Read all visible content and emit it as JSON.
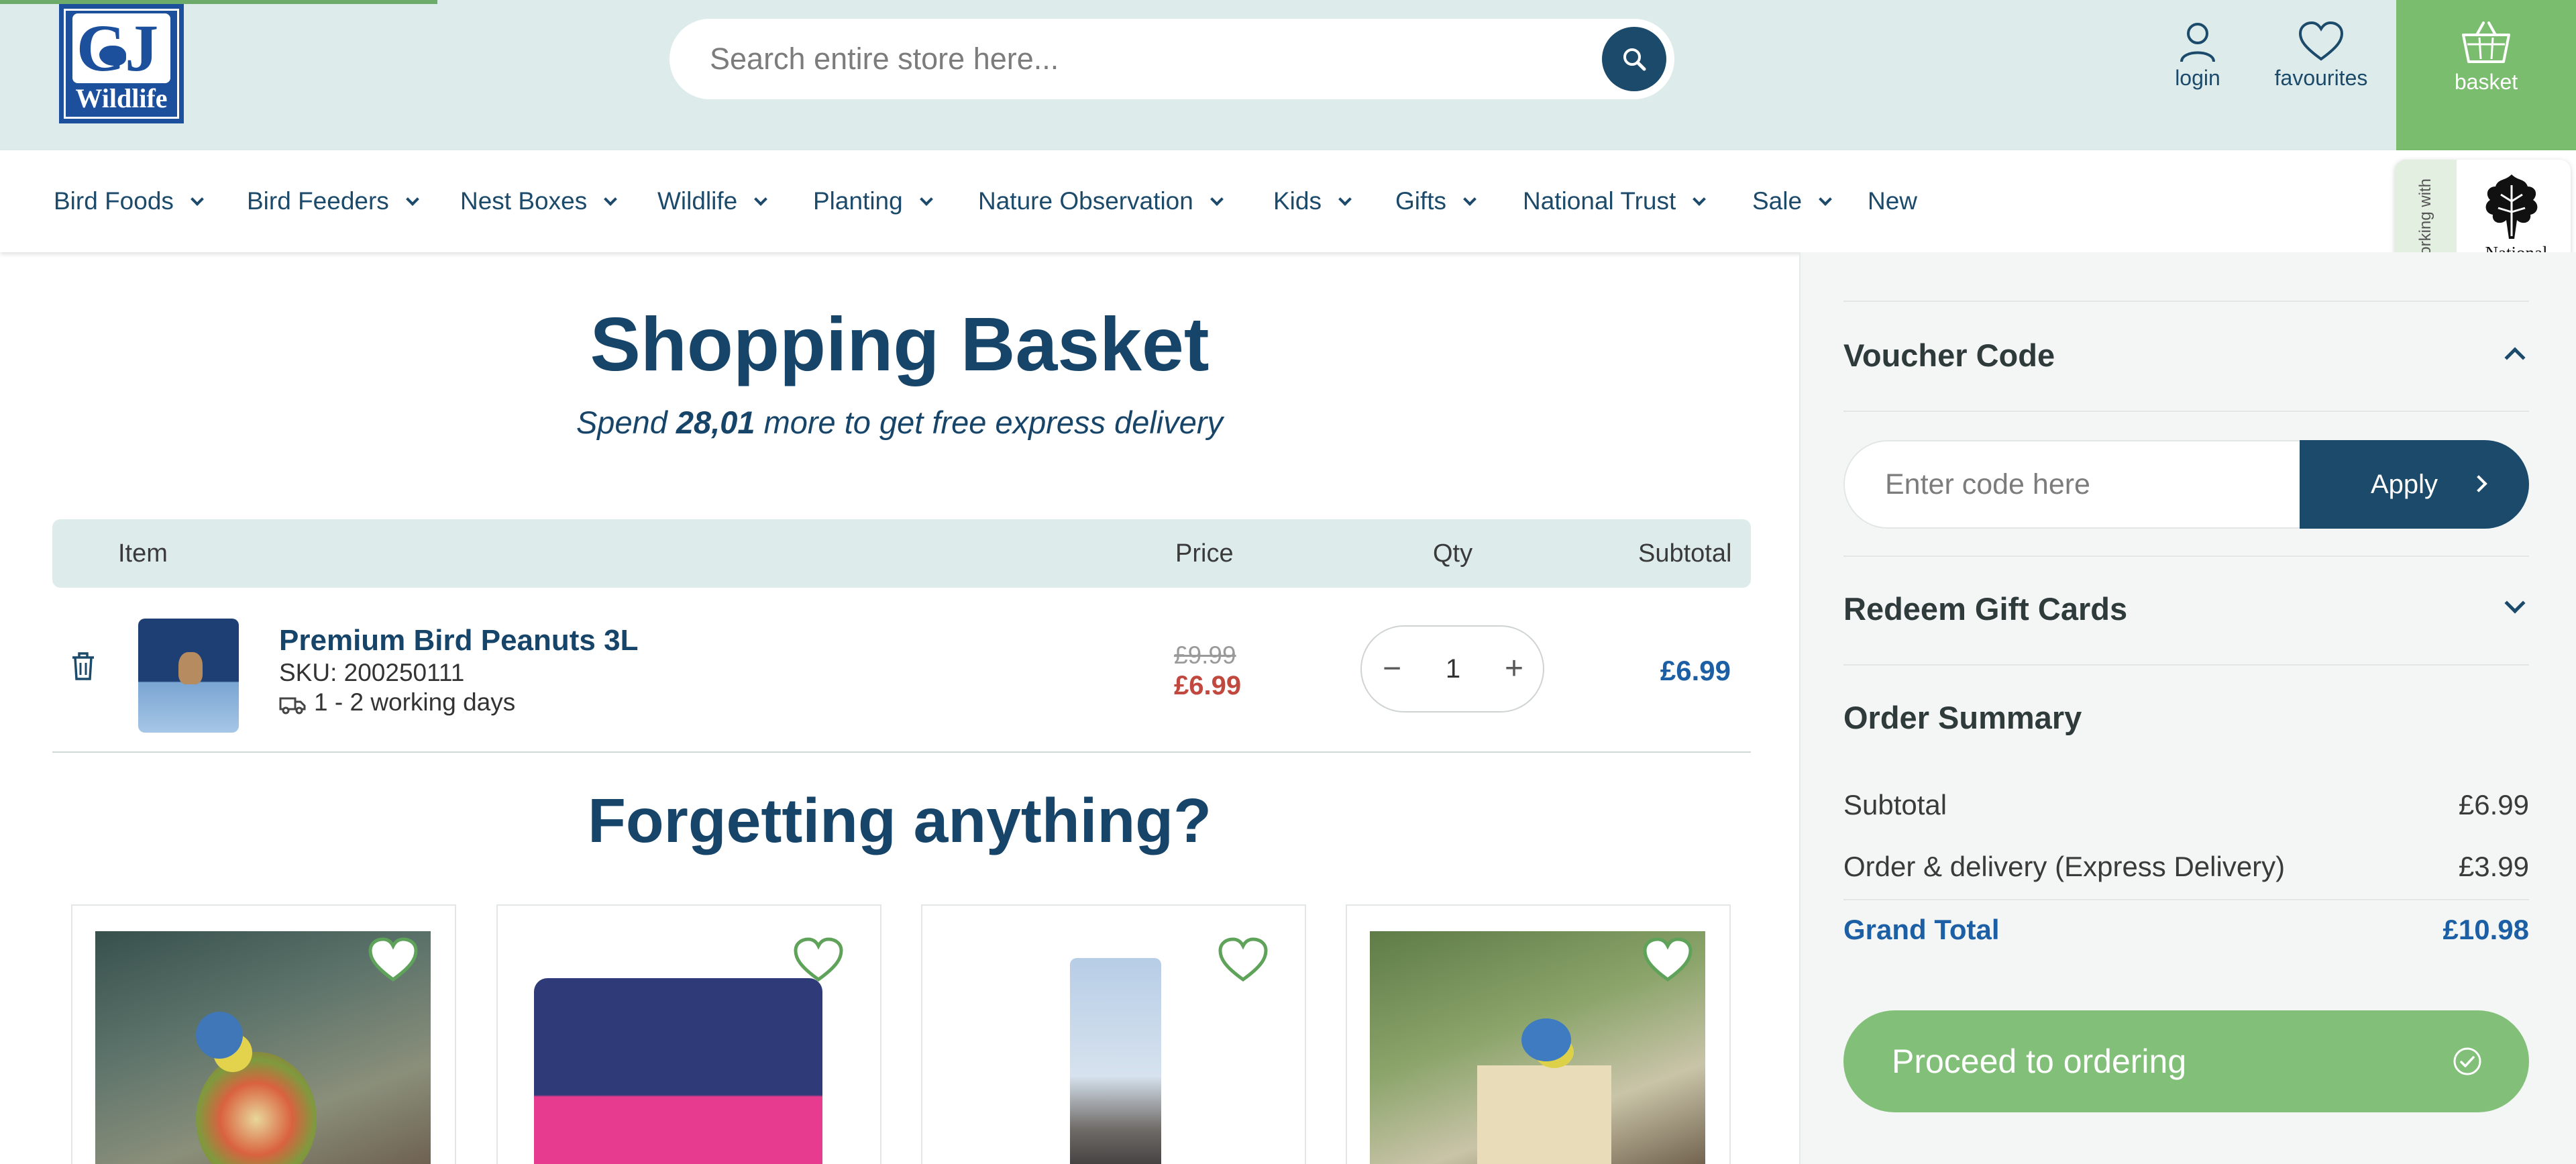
{
  "header": {
    "logo_letters": "CJ",
    "logo_text": "Wildlife",
    "search_placeholder": "Search entire store here...",
    "login_label": "login",
    "favourites_label": "favourites",
    "basket_label": "basket"
  },
  "nav": {
    "items": [
      "Bird Foods",
      "Bird Feeders",
      "Nest Boxes",
      "Wildlife",
      "Planting",
      "Nature Observation",
      "Kids",
      "Gifts",
      "National Trust",
      "Sale",
      "New"
    ],
    "badge_tab": "working with",
    "badge_name": "National Trust"
  },
  "page": {
    "title": "Shopping Basket",
    "delivery_prefix": "Spend",
    "delivery_amount": "28,01",
    "delivery_suffix": "more to get free express delivery",
    "forgetting": "Forgetting anything?"
  },
  "table": {
    "headers": {
      "item": "Item",
      "price": "Price",
      "qty": "Qty",
      "subtotal": "Subtotal"
    },
    "rows": [
      {
        "name": "Premium Bird Peanuts 3L",
        "sku": "SKU: 200250111",
        "shipping": "1 - 2 working days",
        "old_price": "£9.99",
        "price": "£6.99",
        "qty": "1",
        "subtotal": "£6.99"
      }
    ]
  },
  "sidebar": {
    "voucher_title": "Voucher Code",
    "voucher_placeholder": "Enter code here",
    "apply_label": "Apply",
    "gift_title": "Redeem Gift Cards",
    "summary_title": "Order Summary",
    "subtotal_label": "Subtotal",
    "subtotal_value": "£6.99",
    "delivery_label": "Order & delivery (Express Delivery)",
    "delivery_value": "£3.99",
    "grand_label": "Grand Total",
    "grand_value": "£10.98",
    "proceed_label": "Proceed to ordering"
  },
  "colors": {
    "header_bg": "#ddeceb",
    "primary": "#1c4a6b",
    "accent_green": "#82c079",
    "price_red": "#c0483f",
    "link_blue": "#1c5fa5"
  }
}
